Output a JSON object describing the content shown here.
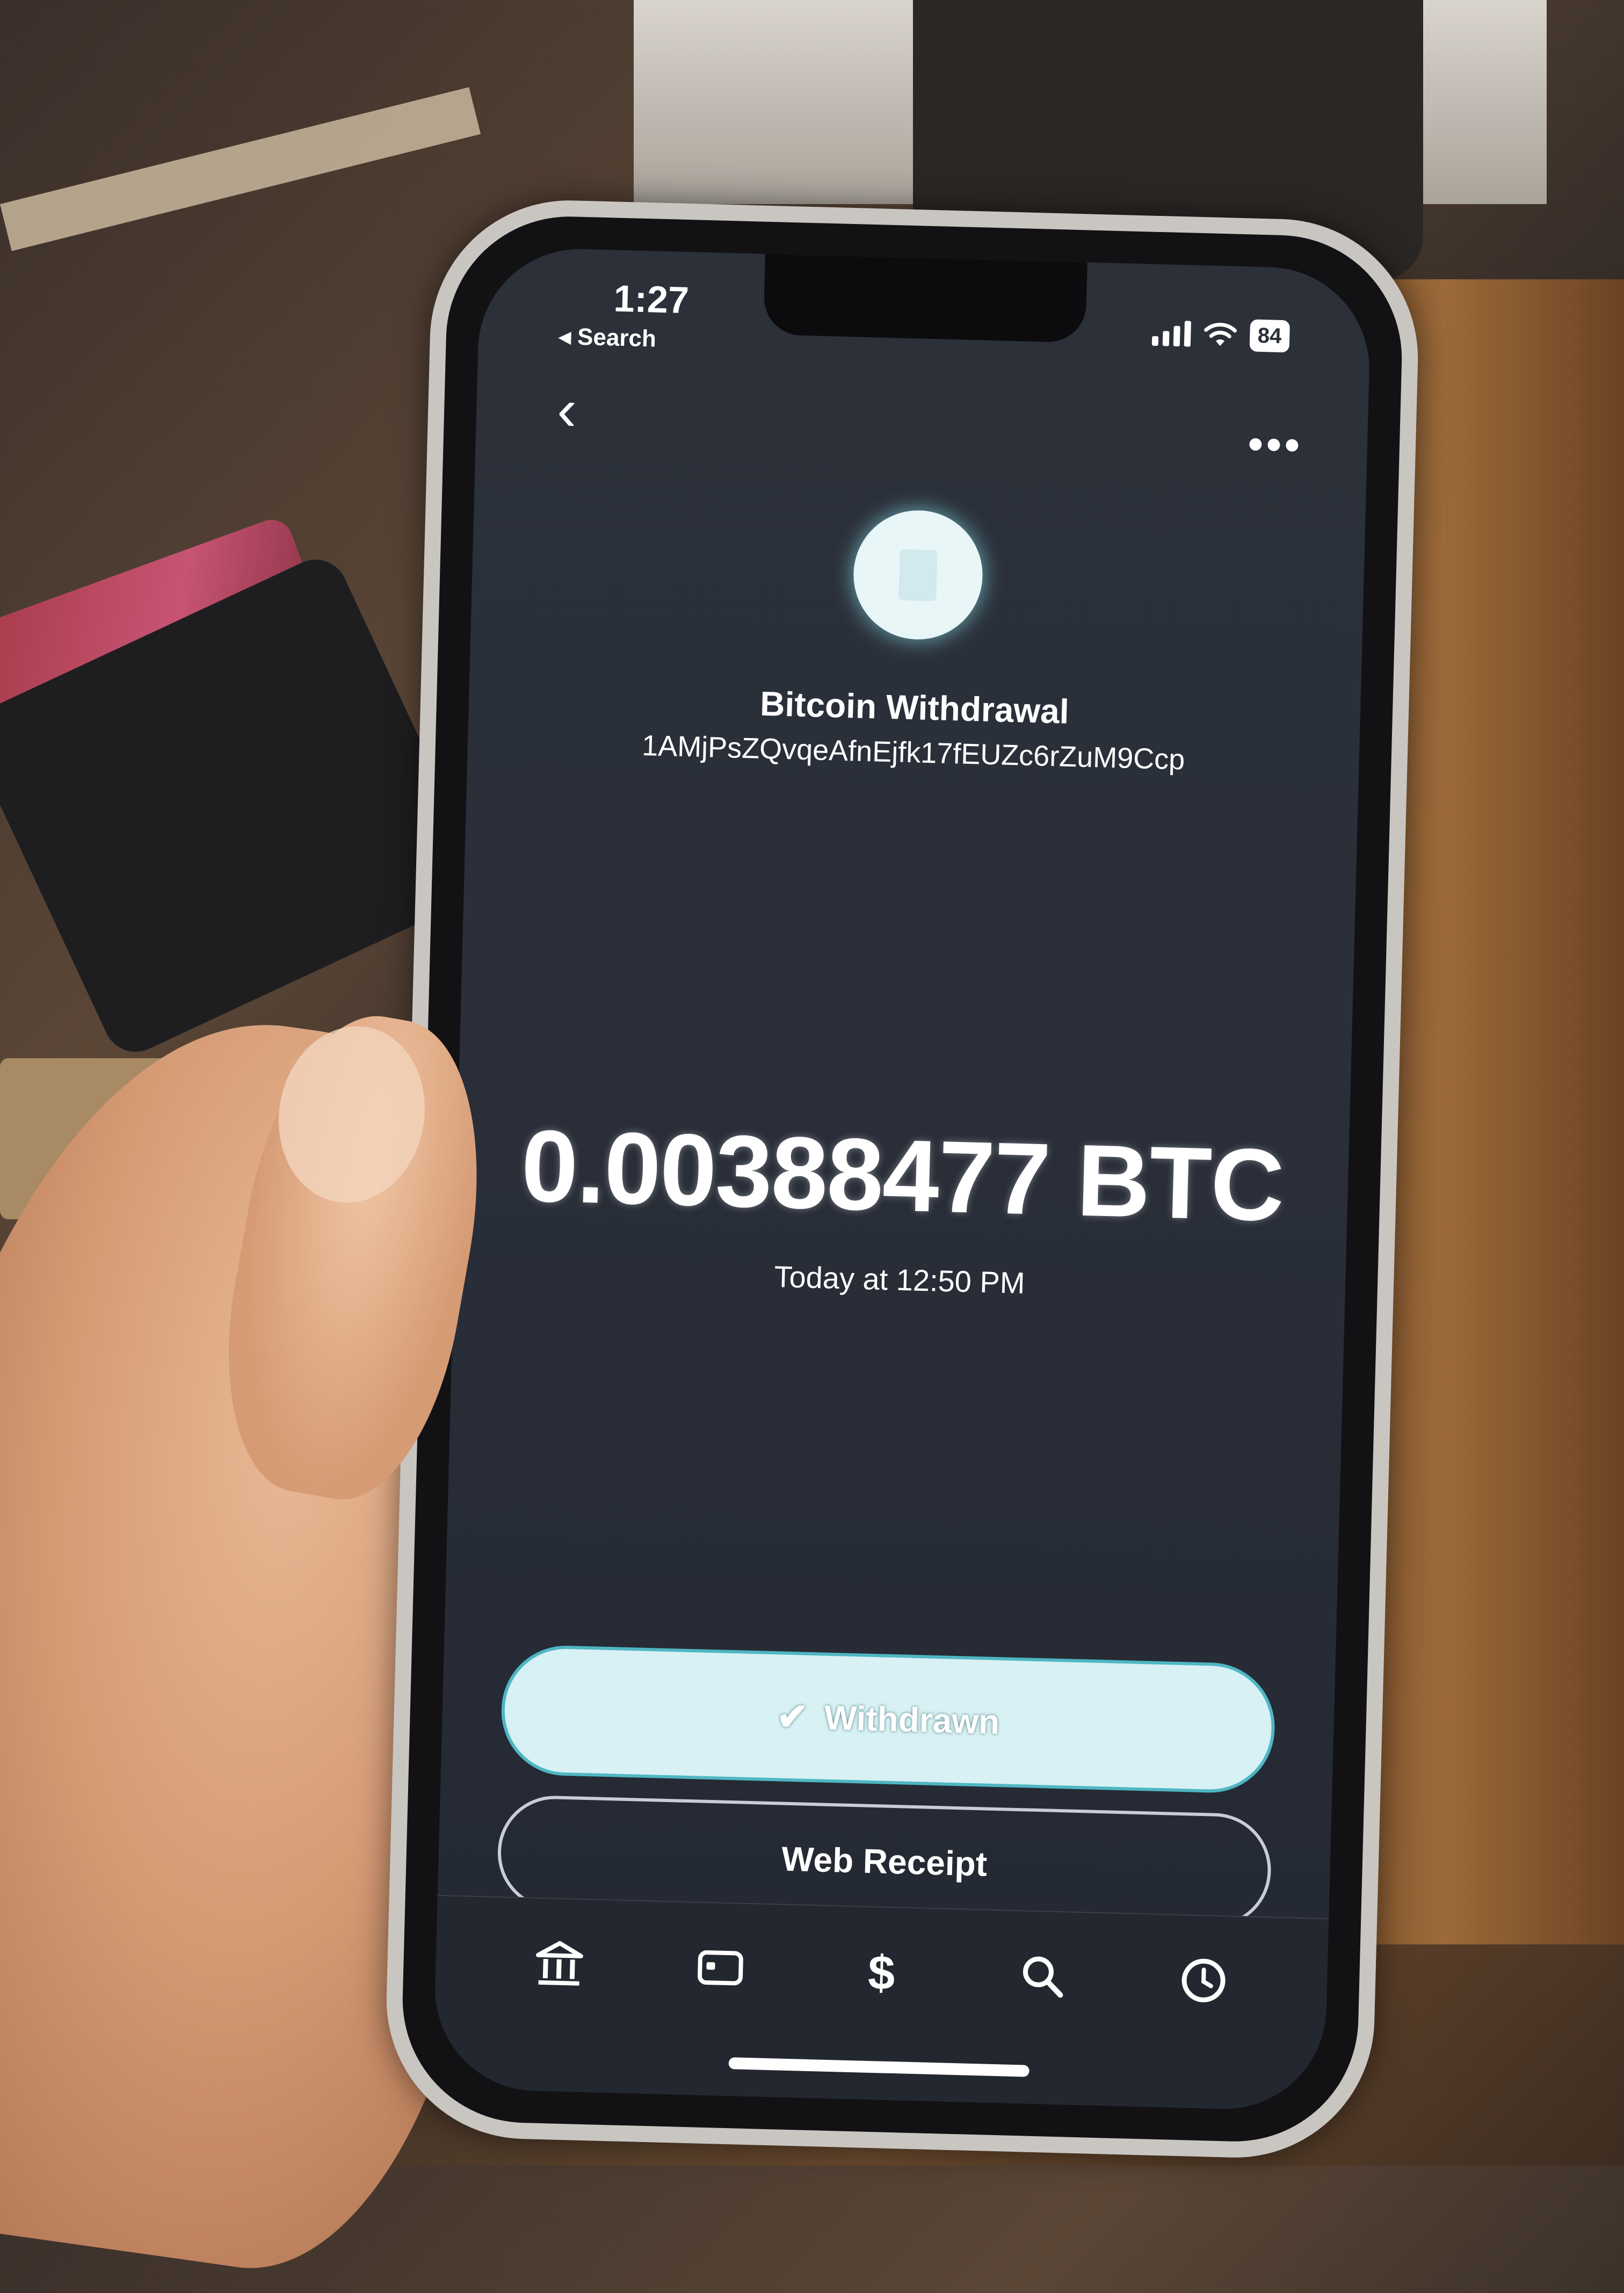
{
  "status_bar": {
    "time": "1:27",
    "back_label": "◂ Search",
    "battery": "84"
  },
  "header": {
    "title": "Bitcoin Withdrawal",
    "address": "1AMjPsZQvqeAfnEjfk17fEUZc6rZuM9Ccp"
  },
  "transaction": {
    "amount": "0.00388477 BTC",
    "timestamp": "Today at 12:50 PM"
  },
  "actions": {
    "withdrawn_label": "Withdrawn",
    "web_receipt_label": "Web Receipt"
  },
  "tabbar": {
    "items": [
      "bank-icon",
      "card-icon",
      "dollar-icon",
      "search-icon",
      "activity-icon"
    ]
  },
  "colors": {
    "screen_bg": "#2a2f3a",
    "accent": "#4fb6c4",
    "button_fill": "#d8f1f4"
  }
}
